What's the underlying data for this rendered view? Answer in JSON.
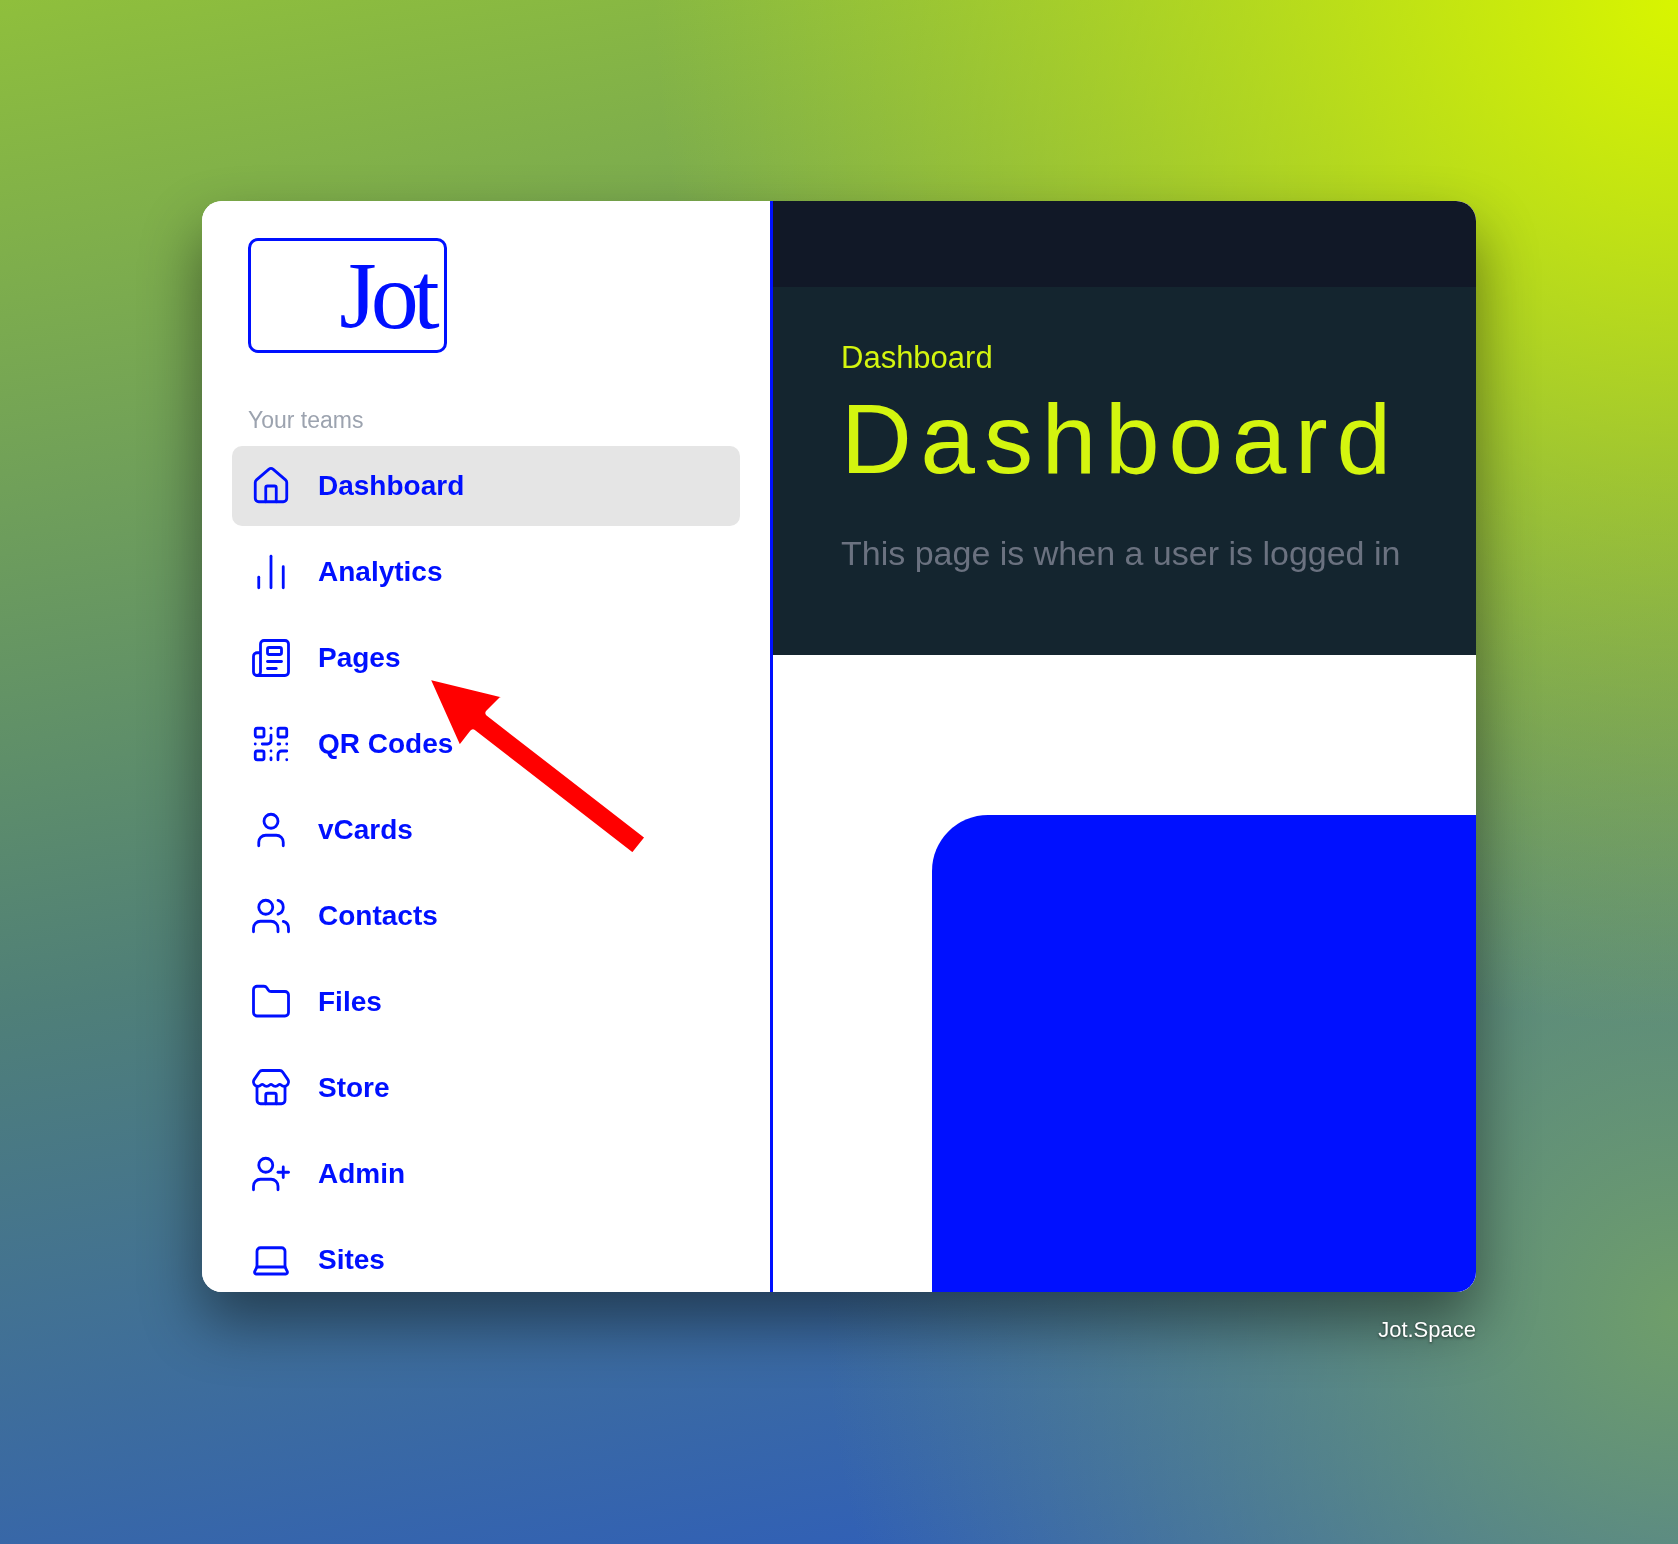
{
  "logo": {
    "text": "Jot"
  },
  "sidebar": {
    "section_label": "Your teams",
    "items": [
      {
        "label": "Dashboard",
        "selected": true
      },
      {
        "label": "Analytics",
        "selected": false
      },
      {
        "label": "Pages",
        "selected": false
      },
      {
        "label": "QR Codes",
        "selected": false
      },
      {
        "label": "vCards",
        "selected": false
      },
      {
        "label": "Contacts",
        "selected": false
      },
      {
        "label": "Files",
        "selected": false
      },
      {
        "label": "Store",
        "selected": false
      },
      {
        "label": "Admin",
        "selected": false
      },
      {
        "label": "Sites",
        "selected": false
      }
    ]
  },
  "header": {
    "breadcrumb": "Dashboard",
    "title": "Dashboard",
    "subtitle": "This page is when a user is logged in"
  },
  "caption": "Jot.Space"
}
